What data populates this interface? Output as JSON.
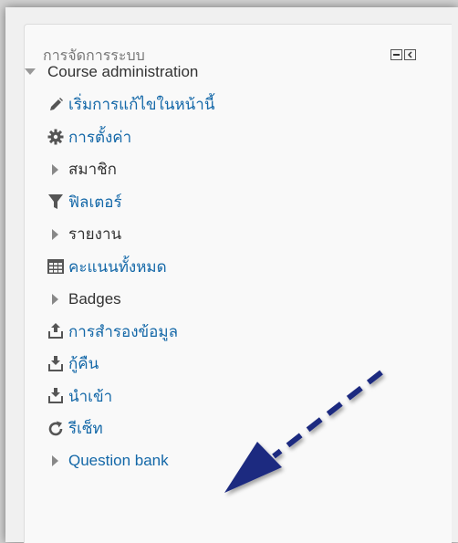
{
  "block": {
    "title": "การจัดการระบบ",
    "controls": [
      "minimize-icon",
      "dock-icon"
    ]
  },
  "tree": {
    "root_label": "Course administration",
    "items": [
      {
        "label": "เริ่มการแก้ไขในหน้านี้",
        "icon": "pencil-icon",
        "type": "link"
      },
      {
        "label": "การตั้งค่า",
        "icon": "gear-icon",
        "type": "link"
      },
      {
        "label": "สมาชิก",
        "icon": "caret-right-icon",
        "type": "branch"
      },
      {
        "label": "ฟิลเตอร์",
        "icon": "filter-icon",
        "type": "link"
      },
      {
        "label": "รายงาน",
        "icon": "caret-right-icon",
        "type": "branch"
      },
      {
        "label": "คะแนนทั้งหมด",
        "icon": "table-icon",
        "type": "link"
      },
      {
        "label": "Badges",
        "icon": "caret-right-icon",
        "type": "branch"
      },
      {
        "label": "การสำรองข้อมูล",
        "icon": "upload-icon",
        "type": "link"
      },
      {
        "label": "กู้คืน",
        "icon": "download-icon",
        "type": "link"
      },
      {
        "label": "นำเข้า",
        "icon": "download-icon",
        "type": "link"
      },
      {
        "label": "รีเซ็ท",
        "icon": "refresh-icon",
        "type": "link"
      },
      {
        "label": "Question bank",
        "icon": "caret-right-icon",
        "type": "branch-link"
      }
    ]
  },
  "colors": {
    "link": "#1468a8",
    "text": "#333333",
    "annotation_arrow": "#1d2a80"
  }
}
